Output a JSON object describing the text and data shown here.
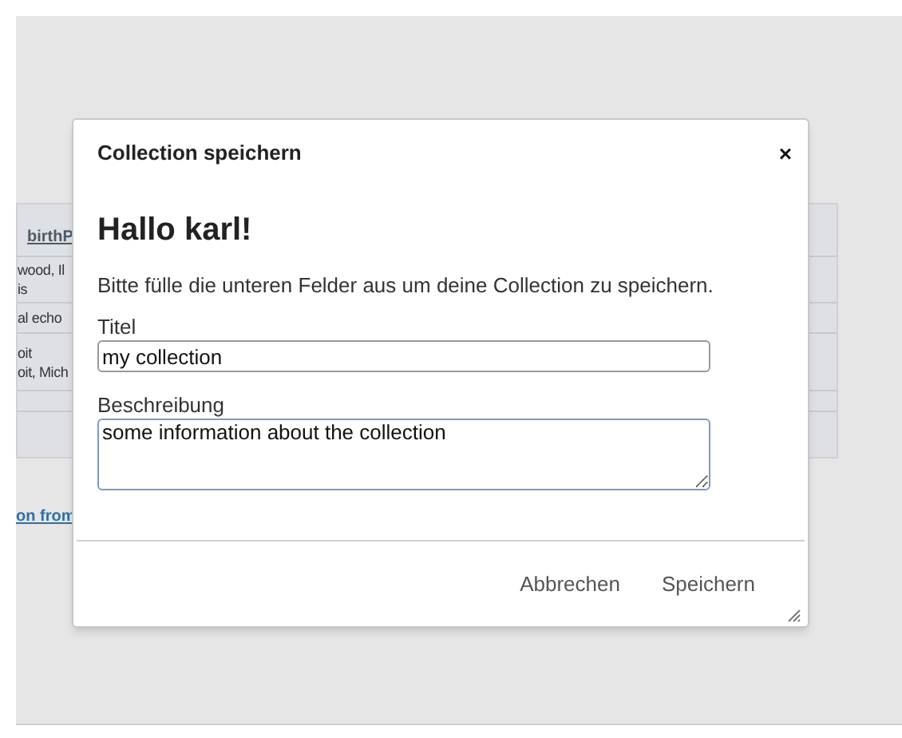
{
  "background": {
    "table": {
      "header": "birthP",
      "rows": [
        {
          "lines": [
            "wood, Il",
            "is"
          ]
        },
        {
          "lines": [
            "al echo"
          ]
        },
        {
          "lines": [
            "oit",
            "oit, Mich"
          ]
        },
        {
          "lines": []
        }
      ]
    },
    "link": "on from"
  },
  "dialog": {
    "title": "Collection speichern",
    "close": "×",
    "heading": "Hallo karl!",
    "intro": "Bitte fülle die unteren Felder aus um deine Collection zu speichern.",
    "fields": [
      {
        "kind": "input",
        "label": "Titel",
        "value": "my collection",
        "focused": false
      },
      {
        "kind": "textarea",
        "label": "Beschreibung",
        "value": "some information about the collection",
        "focused": true
      }
    ],
    "buttons": [
      "Abbrechen",
      "Speichern"
    ]
  }
}
